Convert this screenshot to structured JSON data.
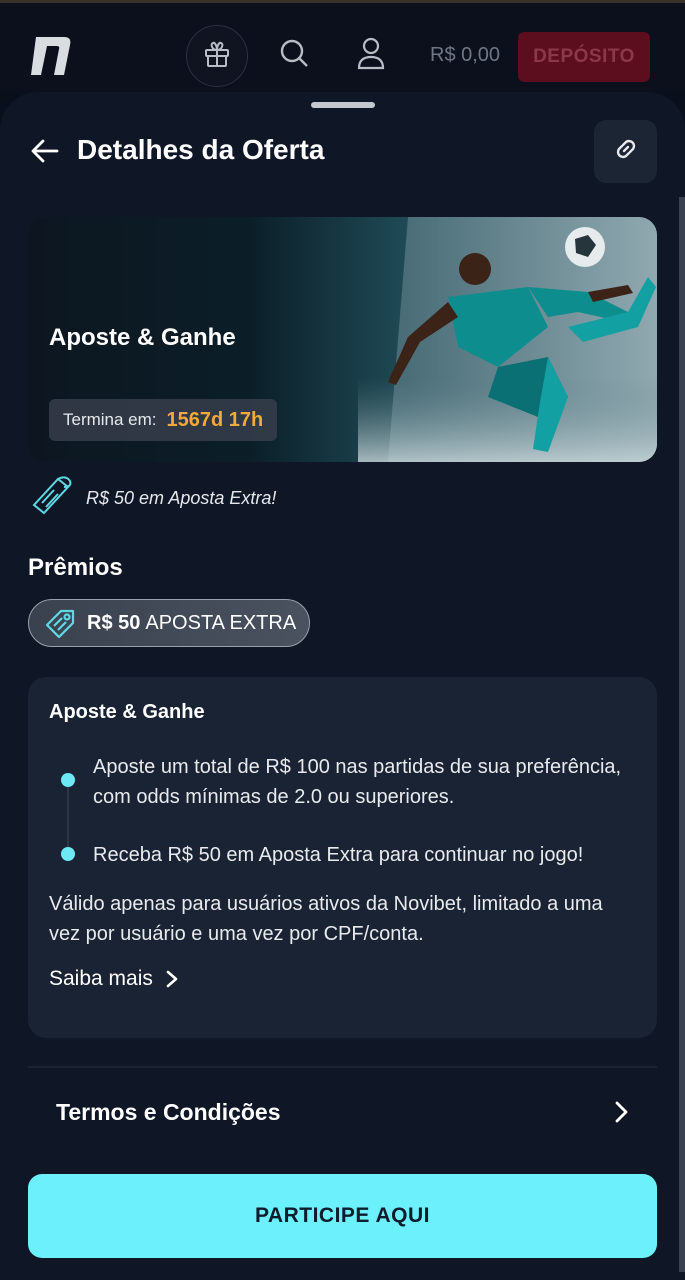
{
  "appbar": {
    "balance": "R$ 0,00",
    "deposit_label": "DEPÓSITO",
    "icons": [
      "logo-icon",
      "gift-icon",
      "search-icon",
      "user-icon"
    ]
  },
  "header": {
    "title": "Detalhes da Oferta"
  },
  "banner": {
    "title": "Aposte & Ganhe",
    "timer_label": "Termina em:",
    "timer_value": "1567d 17h"
  },
  "extra_bet": "R$ 50 em Aposta Extra!",
  "prizes": {
    "title": "Prêmios",
    "amount": "R$ 50",
    "label": "APOSTA EXTRA"
  },
  "offer": {
    "title": "Aposte & Ganhe",
    "steps": [
      "Aposte um total de R$ 100 nas partidas de sua preferência, com odds mínimas de 2.0 ou superiores.",
      "Receba R$ 50 em Aposta Extra para continuar no jogo!"
    ],
    "note": "Válido apenas para usuários ativos da Novibet, limitado a uma vez por usuário e uma vez por CPF/conta.",
    "more_label": "Saiba mais"
  },
  "terms_label": "Termos e Condições",
  "cta_label": "PARTICIPE AQUI",
  "colors": {
    "accent": "#6cf0fb",
    "timer": "#f2a93b",
    "deposit_bg": "#5c0e1e",
    "background": "#0f1626"
  }
}
